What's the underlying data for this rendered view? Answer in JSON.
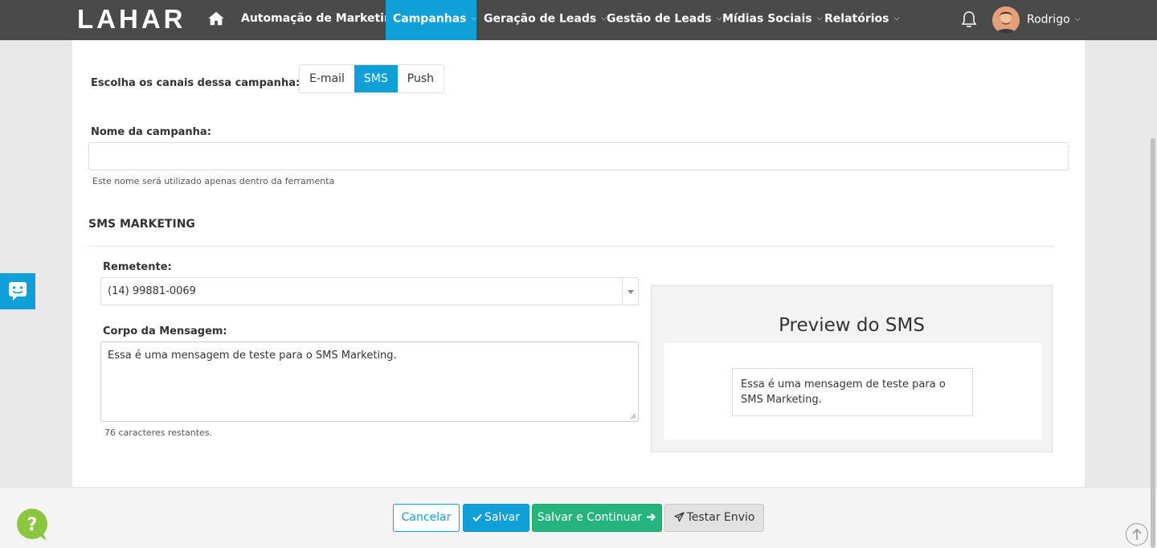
{
  "nav": {
    "logo": "LAHAR",
    "items": [
      {
        "label": "Automação de Marketing",
        "has_caret": false
      },
      {
        "label": "Campanhas",
        "has_caret": true,
        "active": true
      },
      {
        "label": "Geração de Leads",
        "has_caret": true
      },
      {
        "label": "Gestão de Leads",
        "has_caret": true
      },
      {
        "label": "Mídias Sociais",
        "has_caret": true
      },
      {
        "label": "Relatórios",
        "has_caret": true
      }
    ],
    "user_name": "Rodrigo",
    "caret": "⌄"
  },
  "form": {
    "channels_label": "Escolha os canais dessa campanha:",
    "channels": [
      "E-mail",
      "SMS",
      "Push"
    ],
    "active_channel": "SMS",
    "campaign_name_label": "Nome da campanha:",
    "campaign_name_value": "",
    "campaign_name_help": "Este nome será utilizado apenas dentro da ferramenta",
    "section_title": "SMS MARKETING",
    "sender_label": "Remetente:",
    "sender_value": "(14) 99881-0069",
    "body_label": "Corpo da Mensagem:",
    "body_value": "Essa é uma mensagem de teste para o SMS Marketing.",
    "chars_remaining": "76 caracteres restantes."
  },
  "preview": {
    "title": "Preview do SMS",
    "message": "Essa é uma mensagem de teste para o SMS Marketing."
  },
  "actions": {
    "cancel": "Cancelar",
    "save": "Salvar",
    "save_continue": "Salvar e Continuar",
    "test_send": "Testar Envio"
  },
  "colors": {
    "accent": "#0fa0d8",
    "success": "#25b47e",
    "navbar": "#4a4a4a",
    "help_widget": "#8cc63f"
  }
}
